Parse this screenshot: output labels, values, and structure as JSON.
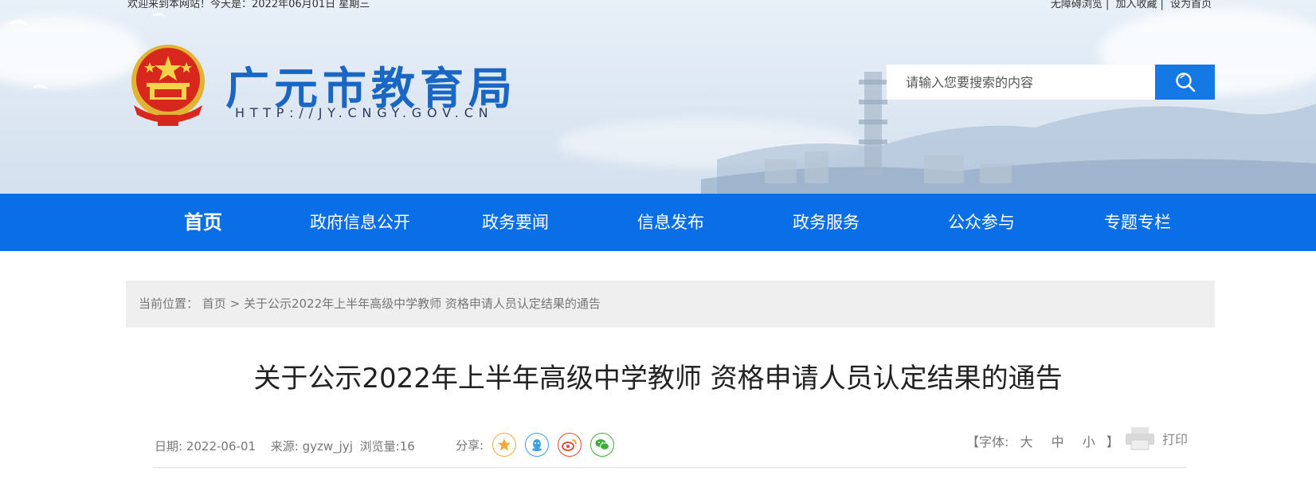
{
  "topbar": {
    "welcome": "欢迎来到本网站！今天是：2022年06月01日 星期三",
    "links": [
      "无障碍浏览",
      "加入收藏",
      "设为首页"
    ]
  },
  "header": {
    "site_name": "广元市教育局",
    "site_url": "HTTP://JY.CNGY.GOV.CN",
    "search_placeholder": "请输入您要搜索的内容"
  },
  "nav": {
    "items": [
      "首页",
      "政府信息公开",
      "政务要闻",
      "信息发布",
      "政务服务",
      "公众参与",
      "专题专栏"
    ],
    "active": "首页"
  },
  "breadcrumb": {
    "label": "当前位置：",
    "home": "首页",
    "separator": ">",
    "current": "关于公示2022年上半年高级中学教师 资格申请人员认定结果的通告"
  },
  "article": {
    "title": "关于公示2022年上半年高级中学教师 资格申请人员认定结果的通告",
    "date": "日期: 2022-06-01",
    "source": "来源: gyzw_jyj",
    "views": "浏览量:16",
    "share_label": "分享:",
    "share_icons": [
      "qzone-icon",
      "qq-icon",
      "weibo-icon",
      "wechat-icon"
    ],
    "font_label_open": "【字体:",
    "font_sizes": [
      "大",
      "中",
      "小"
    ],
    "font_label_close": "】",
    "print_label": "打印"
  },
  "colors": {
    "nav_bg": "#0a6fe6",
    "site_name": "#1a66c4",
    "search_button": "#1479e5",
    "breadcrumb_bg": "#efefef"
  }
}
